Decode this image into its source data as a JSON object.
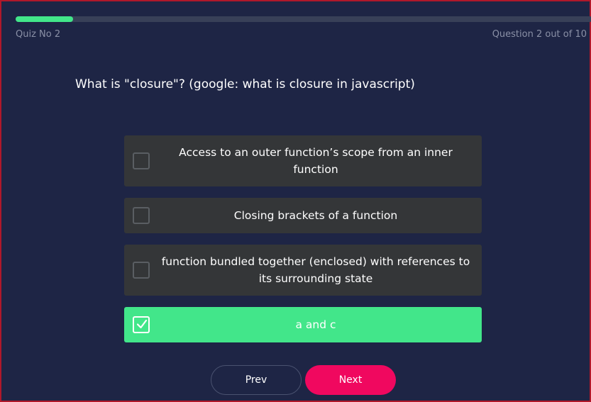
{
  "progress": {
    "fraction": 0.1
  },
  "header": {
    "quiz_label": "Quiz No 2",
    "question_count": "Question 2 out of 10"
  },
  "question": {
    "text": "What is \"closure\"? (google: what is closure in javascript)"
  },
  "options": [
    {
      "label": "Access to an outer function’s scope from an inner function",
      "checked": false
    },
    {
      "label": "Closing brackets of a function",
      "checked": false
    },
    {
      "label": "function bundled together (enclosed) with references to its surrounding state",
      "checked": false
    },
    {
      "label": "a and c",
      "checked": true
    }
  ],
  "buttons": {
    "prev_label": "Prev",
    "next_label": "Next"
  },
  "colors": {
    "background": "#1e2545",
    "accent_green": "#42e68a",
    "accent_pink": "#f0085f",
    "option_bg": "#343638"
  },
  "icons": {
    "checkbox": "checkbox-icon",
    "checked": "check-icon"
  }
}
